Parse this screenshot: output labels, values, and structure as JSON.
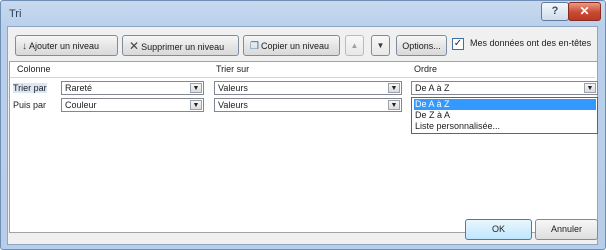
{
  "window": {
    "title": "Tri",
    "help_label": "?",
    "close_label": "✕"
  },
  "toolbar": {
    "add_level": "Ajouter un niveau",
    "delete_level": "Supprimer un niveau",
    "copy_level": "Copier un niveau",
    "move_up": "▲",
    "move_down": "▼",
    "options": "Options...",
    "has_headers_label": "Mes données ont des en-têtes",
    "has_headers_checked": true
  },
  "grid": {
    "headers": {
      "column": "Colonne",
      "sort_on": "Trier sur",
      "order": "Ordre"
    },
    "rows": [
      {
        "label": "Trier par",
        "column": "Rareté",
        "sort_on": "Valeurs",
        "order": "De A à Z"
      },
      {
        "label": "Puis par",
        "column": "Couleur",
        "sort_on": "Valeurs",
        "order": ""
      }
    ]
  },
  "order_dropdown": {
    "options": [
      "De A à Z",
      "De Z à A",
      "Liste personnalisée..."
    ],
    "selected_index": 0
  },
  "footer": {
    "ok": "OK",
    "cancel": "Annuler"
  }
}
